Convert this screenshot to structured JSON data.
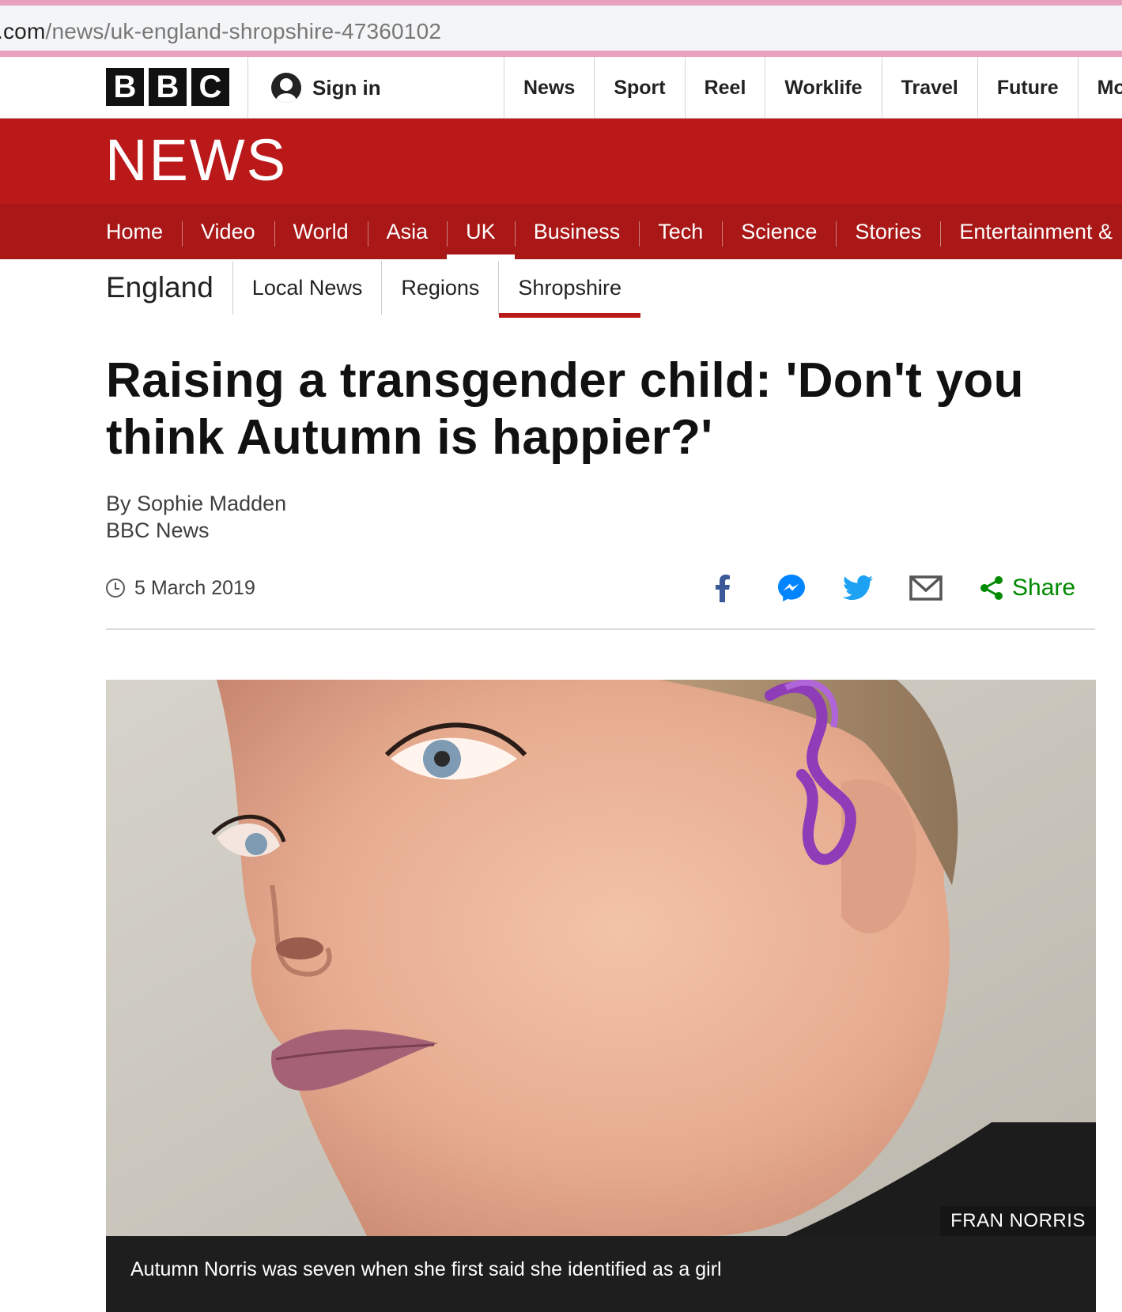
{
  "browser": {
    "url_domain": ".com",
    "url_path": "/news/uk-england-shropshire-47360102"
  },
  "masthead": {
    "logo_letters": [
      "B",
      "B",
      "C"
    ],
    "signin_label": "Sign in",
    "nav_items": [
      "News",
      "Sport",
      "Reel",
      "Worklife",
      "Travel",
      "Future",
      "Mo"
    ]
  },
  "news_banner": {
    "logo_text": "NEWS",
    "accent_color": "#bb1919"
  },
  "section_nav": {
    "items": [
      "Home",
      "Video",
      "World",
      "Asia",
      "UK",
      "Business",
      "Tech",
      "Science",
      "Stories",
      "Entertainment &"
    ],
    "active": "UK"
  },
  "sub_nav": {
    "region": "England",
    "items": [
      "Local News",
      "Regions",
      "Shropshire"
    ],
    "selected": "Shropshire"
  },
  "article": {
    "headline": "Raising a transgender child: 'Don't you think Autumn is happier?'",
    "byline_author": "By Sophie Madden",
    "byline_org": "BBC News",
    "date": "5 March 2019"
  },
  "share": {
    "icons": [
      "facebook-icon",
      "messenger-icon",
      "twitter-icon",
      "email-icon",
      "share-icon"
    ],
    "label": "Share",
    "label_color": "#008a00"
  },
  "hero_image": {
    "credit": "FRAN NORRIS",
    "caption": "Autumn Norris was seven when she first said she identified as a girl"
  }
}
